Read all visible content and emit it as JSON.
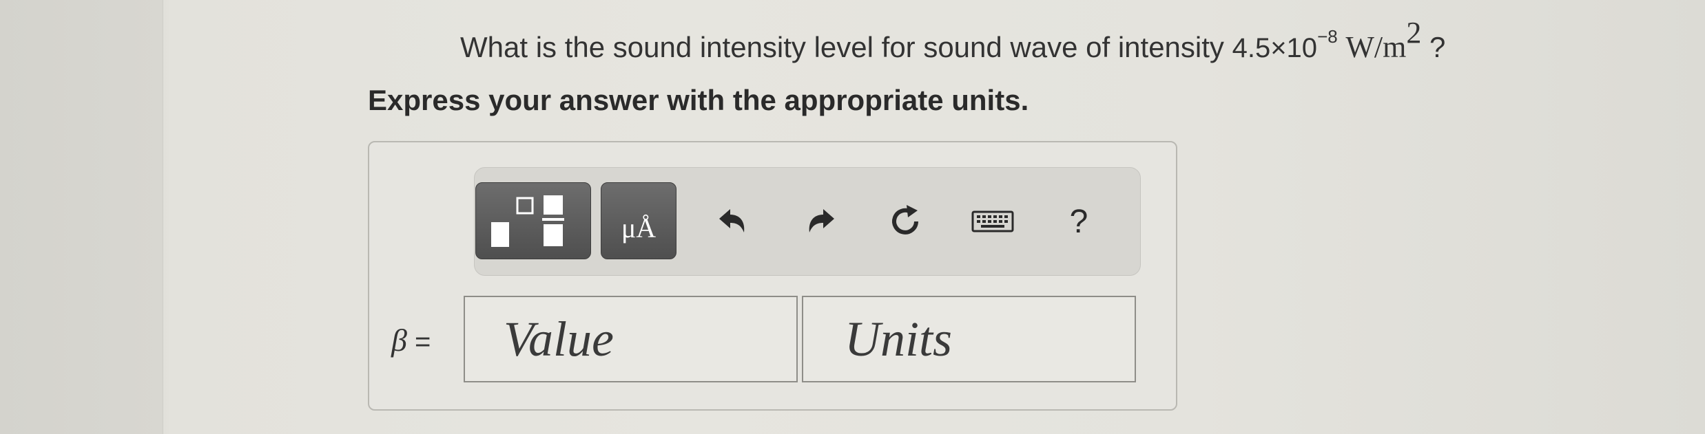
{
  "question": {
    "prefix": "What is the sound intensity level for sound wave of intensity ",
    "mantissa": "4.5×10",
    "exponent": "−8",
    "unit": "W/m",
    "unit_exponent": "2",
    "suffix": " ?"
  },
  "instruction": "Express your answer with the appropriate units.",
  "toolbar": {
    "templates_icon": "fraction-templates-icon",
    "units_label": "μÅ",
    "undo_icon": "undo-icon",
    "redo_icon": "redo-icon",
    "reset_icon": "reset-icon",
    "keyboard_icon": "keyboard-icon",
    "help_label": "?"
  },
  "answer": {
    "variable": "β",
    "equals": " =",
    "value_placeholder": "Value",
    "units_placeholder": "Units"
  }
}
